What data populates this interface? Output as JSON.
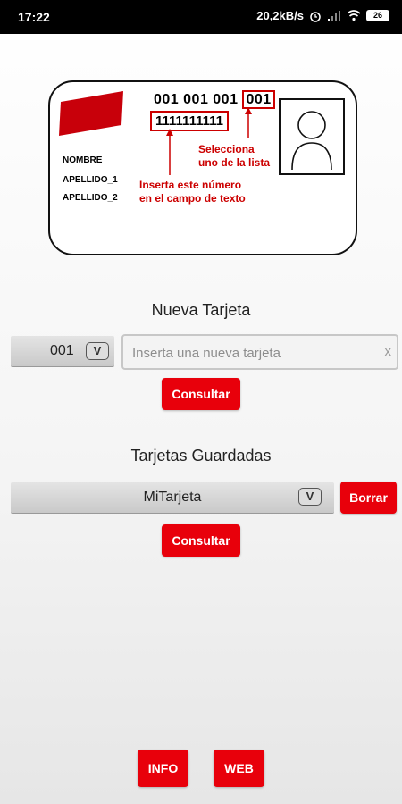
{
  "status_bar": {
    "time": "17:22",
    "network_speed": "20,2kB/s",
    "battery": "26",
    "icons": [
      "alarm-icon",
      "signal-icon",
      "wifi-icon",
      "battery-icon"
    ]
  },
  "card_illustration": {
    "number_prefix": "001 001 001",
    "number_selected": "001",
    "number_input": "1111111111",
    "labels": [
      "NOMBRE",
      "APELLIDO_1",
      "APELLIDO_2"
    ],
    "annotation_select": "Selecciona\nuno de la lista",
    "annotation_insert": "Inserta este número\nen el campo de texto"
  },
  "new_card": {
    "title": "Nueva Tarjeta",
    "prefix_value": "001",
    "dropdown_label": "V",
    "input_placeholder": "Inserta una nueva tarjeta",
    "clear_label": "x",
    "consult_label": "Consultar"
  },
  "saved_cards": {
    "title": "Tarjetas Guardadas",
    "selected_value": "MiTarjeta",
    "dropdown_label": "V",
    "delete_label": "Borrar",
    "consult_label": "Consultar"
  },
  "footer": {
    "info_label": "INFO",
    "web_label": "WEB"
  },
  "colors": {
    "accent": "#e8000b",
    "annotation": "#cc0000"
  }
}
